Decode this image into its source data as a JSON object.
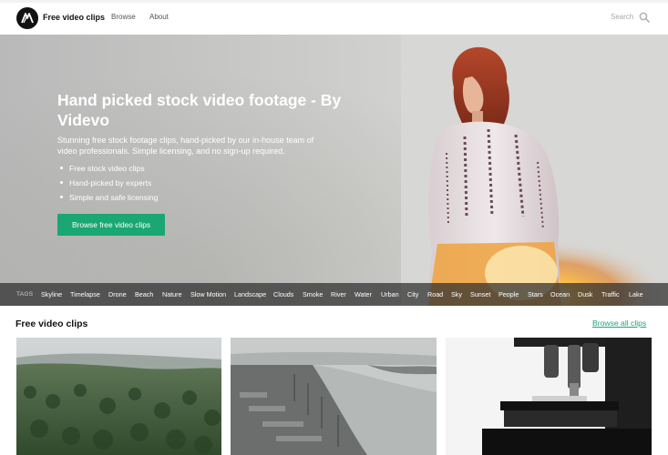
{
  "header": {
    "logo_icon": "videvo-logo-icon",
    "brand": "Free video clips",
    "nav": [
      {
        "label": "Browse"
      },
      {
        "label": "About"
      }
    ],
    "search": {
      "label": "Search",
      "icon": "search-icon"
    }
  },
  "hero": {
    "title": "Hand picked stock video footage - By Videvo",
    "description": "Stunning free stock footage clips, hand-picked by our in-house team of video professionals. Simple licensing, and no sign-up required.",
    "features": [
      "Free stock video clips",
      "Hand-picked by experts",
      "Simple and safe licensing"
    ],
    "cta_label": "Browse free video clips"
  },
  "tags": {
    "label": "TAGS",
    "items": [
      "Skyline",
      "Timelapse",
      "Drone",
      "Beach",
      "Nature",
      "Slow Motion",
      "Landscape",
      "Clouds",
      "Smoke",
      "River",
      "Water",
      "Urban",
      "City",
      "Road",
      "Sky",
      "Sunset",
      "People",
      "Stars",
      "Ocean",
      "Dusk",
      "Traffic",
      "Lake"
    ]
  },
  "clips": {
    "title": "Free video clips",
    "browse_all": "Browse all clips"
  },
  "colors": {
    "accent": "#1aa774",
    "tagbar": "#2d2d2d",
    "text": "#111111"
  }
}
